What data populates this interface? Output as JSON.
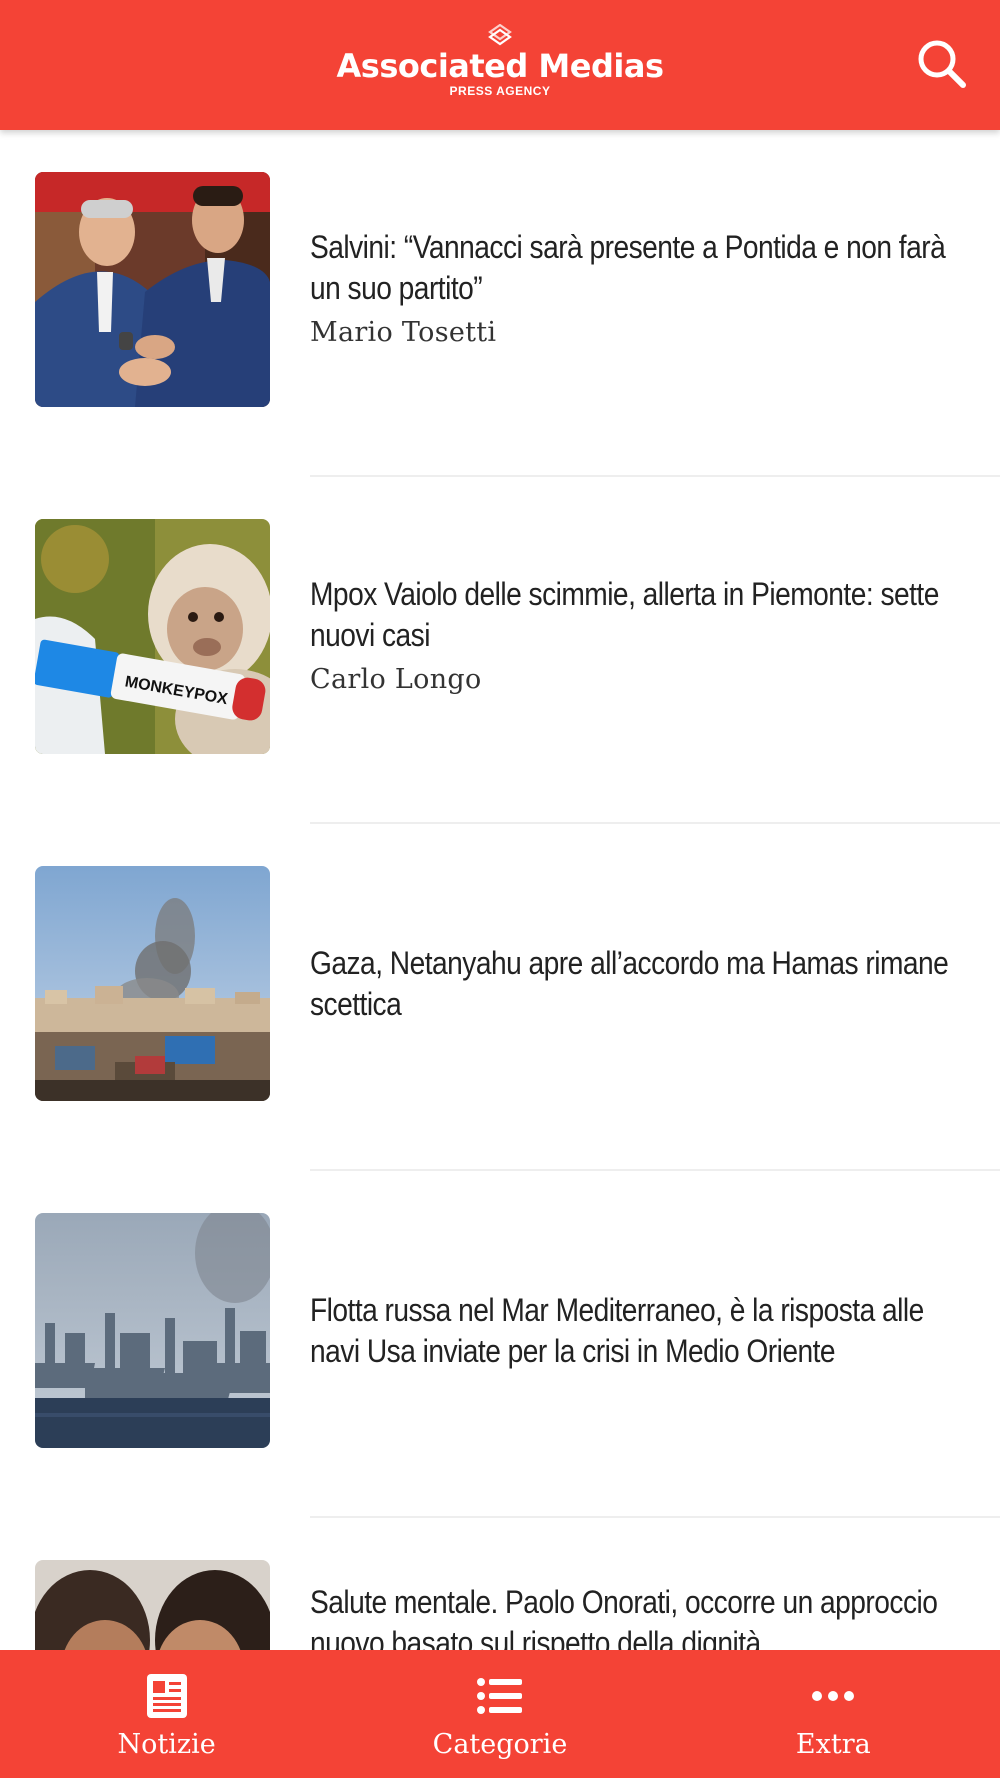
{
  "header": {
    "logo_title": "Associated Medias",
    "logo_subtitle": "PRESS AGENCY",
    "search_icon": "search-icon",
    "background_color": "#f44336"
  },
  "articles": [
    {
      "title": "Salvini: “Vannacci sarà presente a Pontida e non farà un suo partito”",
      "author": "Mario Tosetti",
      "image": "two men in suits smiling photo"
    },
    {
      "title": "Mpox Vaiolo delle scimmie, allerta in Piemonte: sette nuovi casi",
      "author": "Carlo Longo",
      "image": "monkey with test tube photo",
      "image_text": "MONKEYPOX"
    },
    {
      "title": "Gaza, Netanyahu apre all’accordo ma Hamas rimane scettica",
      "author": "",
      "image": "smoke over city photo"
    },
    {
      "title": "Flotta russa nel Mar Mediterraneo, è la risposta alle navi Usa inviate per la crisi in Medio Oriente",
      "author": "",
      "image": "warships at sea photo"
    },
    {
      "title": "Salute mentale. Paolo Onorati, occorre un approccio nuovo basato sul rispetto della dignità",
      "author": "",
      "image": "two faces photo"
    }
  ],
  "bottom_nav": {
    "items": [
      {
        "label": "Notizie",
        "icon": "newspaper-icon"
      },
      {
        "label": "Categorie",
        "icon": "list-icon"
      },
      {
        "label": "Extra",
        "icon": "more-dots-icon"
      }
    ]
  },
  "colors": {
    "accent": "#f44336",
    "text": "#222222",
    "divider": "#eeeeee"
  }
}
